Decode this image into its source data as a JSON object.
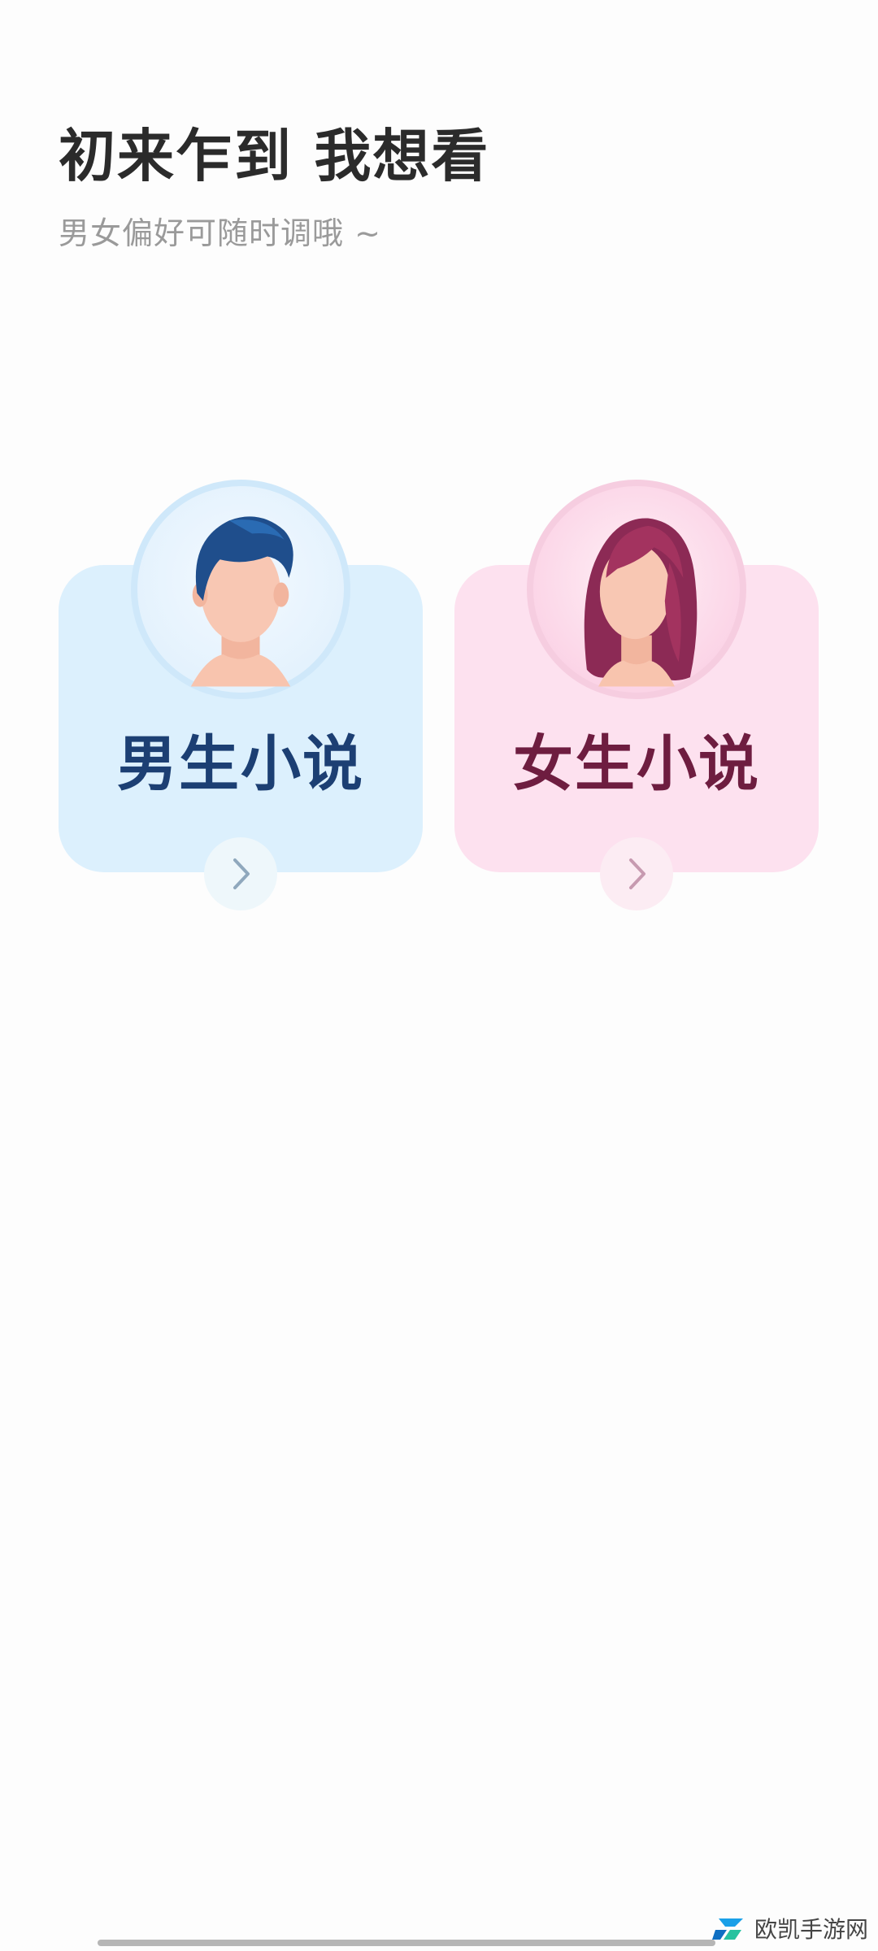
{
  "header": {
    "title": "初来乍到 我想看",
    "subtitle": "男女偏好可随时调哦 ~"
  },
  "options": {
    "male": {
      "label": "男生小说",
      "avatar_icon": "male-avatar-icon",
      "arrow_icon": "chevron-right-icon",
      "card_color": "#dcf0fd",
      "text_color": "#1c3f73"
    },
    "female": {
      "label": "女生小说",
      "avatar_icon": "female-avatar-icon",
      "arrow_icon": "chevron-right-icon",
      "card_color": "#fde1ef",
      "text_color": "#6e1d40"
    }
  },
  "watermark": {
    "text": "欧凯手游网",
    "icon": "watermark-logo-icon"
  }
}
